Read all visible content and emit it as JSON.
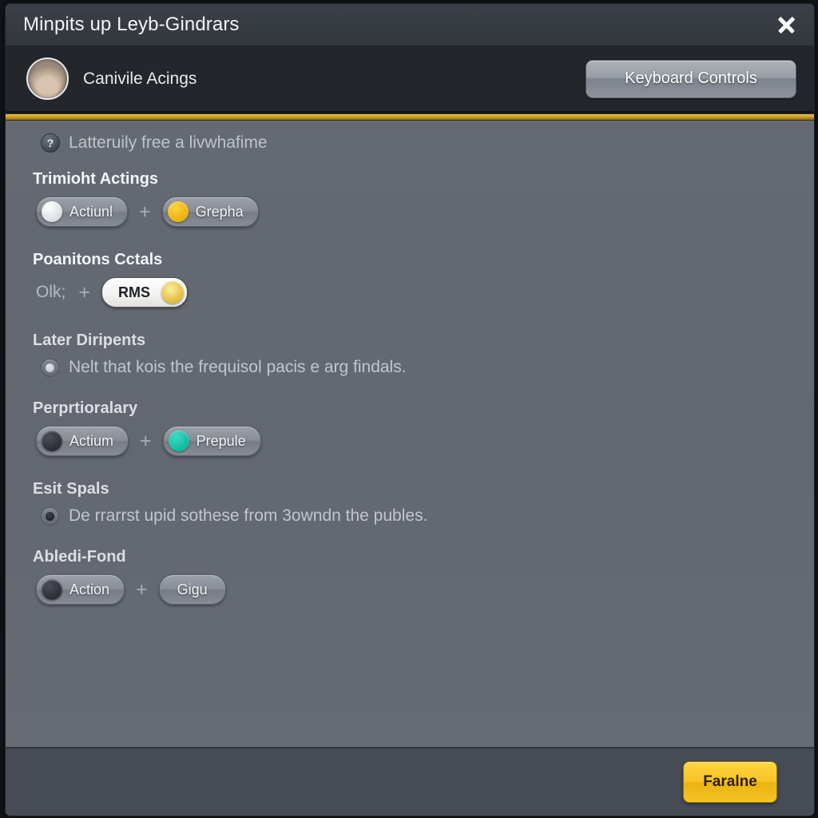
{
  "window": {
    "title": "Minpits up Leyb-Gindrars",
    "close_icon": "close-icon"
  },
  "account_bar": {
    "avatar_icon": "avatar-portrait",
    "account_name": "Canivile Acings",
    "keyboard_button_label": "Keyboard Controls"
  },
  "content": {
    "info": {
      "icon": "help-circle-icon",
      "text": "Latteruily free a livwhafime"
    },
    "sections": [
      {
        "heading": "Trimioht Actings",
        "type": "chips",
        "prefix_label": "",
        "chips": [
          {
            "label": "Actiunl",
            "knob": "white"
          },
          {
            "label": "Grepha",
            "knob": "yellow"
          }
        ],
        "separator": "+"
      },
      {
        "heading": "Poanitons Cctals",
        "type": "chips",
        "prefix_label": "Olk;",
        "chips": [
          {
            "label": "RMS",
            "knob": "yellow",
            "style": "inverted"
          }
        ],
        "separator": "+"
      },
      {
        "heading": "Later Diripents",
        "type": "radio",
        "radio_state": "muted",
        "text": "Nelt that kois the frequisol pacis e arg findals."
      },
      {
        "heading": "Perprtioralary",
        "type": "chips",
        "prefix_label": "",
        "chips": [
          {
            "label": "Actium",
            "knob": "dark"
          },
          {
            "label": "Prepule",
            "knob": "teal"
          }
        ],
        "separator": "+"
      },
      {
        "heading": "Esit Spals",
        "type": "radio",
        "radio_state": "selected",
        "text": "De rrarrst upid sothese from 3owndn the publes."
      },
      {
        "heading": "Abledi-Fond",
        "type": "chips",
        "prefix_label": "",
        "chips": [
          {
            "label": "Action",
            "knob": "dark"
          },
          {
            "label": "Gigu",
            "knob": "none"
          }
        ],
        "separator": "+"
      }
    ]
  },
  "footer": {
    "primary_button_label": "Faralne"
  },
  "colors": {
    "accent_yellow": "#e8c24a",
    "panel_bg": "#656972",
    "titlebar_bg": "#3b3f47",
    "account_bg": "#23262b",
    "footer_bg": "#474c56",
    "teal": "#04b39a"
  }
}
